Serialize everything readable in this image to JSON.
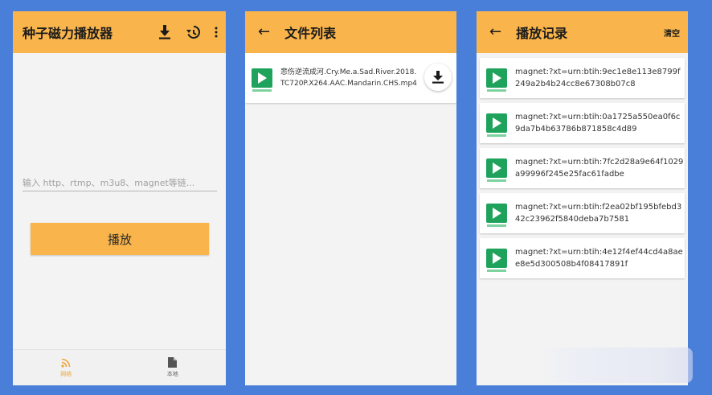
{
  "screen1": {
    "app_title": "种子磁力播放器",
    "input_placeholder": "输入 http、rtmp、m3u8、magnet等链...",
    "play_label": "播放",
    "nav": [
      {
        "label": "网络",
        "icon": "rss-icon",
        "active": true
      },
      {
        "label": "本地",
        "icon": "file-icon",
        "active": false
      }
    ],
    "icons": [
      "download-icon",
      "history-icon",
      "more-vert-icon"
    ]
  },
  "screen2": {
    "title": "文件列表",
    "files": [
      {
        "name": "悲伤逆流成河.Cry.Me.a.Sad.River.2018.TC720P.X264.AAC.Mandarin.CHS.mp4"
      }
    ]
  },
  "screen3": {
    "title": "播放记录",
    "clear_label": "清空",
    "history": [
      {
        "link": "magnet:?xt=urn:btih:9ec1e8e113e8799f249a2b4b24cc8e67308b07c8"
      },
      {
        "link": "magnet:?xt=urn:btih:0a1725a550ea0f6c9da7b4b63786b871858c4d89"
      },
      {
        "link": "magnet:?xt=urn:btih:7fc2d28a9e64f1029a99996f245e25fac61fadbe"
      },
      {
        "link": "magnet:?xt=urn:btih:f2ea02bf195bfebd342c23962f5840deba7b7581"
      },
      {
        "link": "magnet:?xt=urn:btih:4e12f4ef44cd4a8aee8e5d300508b4f08417891f"
      }
    ]
  },
  "colors": {
    "accent": "#f9b44b",
    "background": "#4a7fd9",
    "thumb_green": "#1fa35c"
  }
}
